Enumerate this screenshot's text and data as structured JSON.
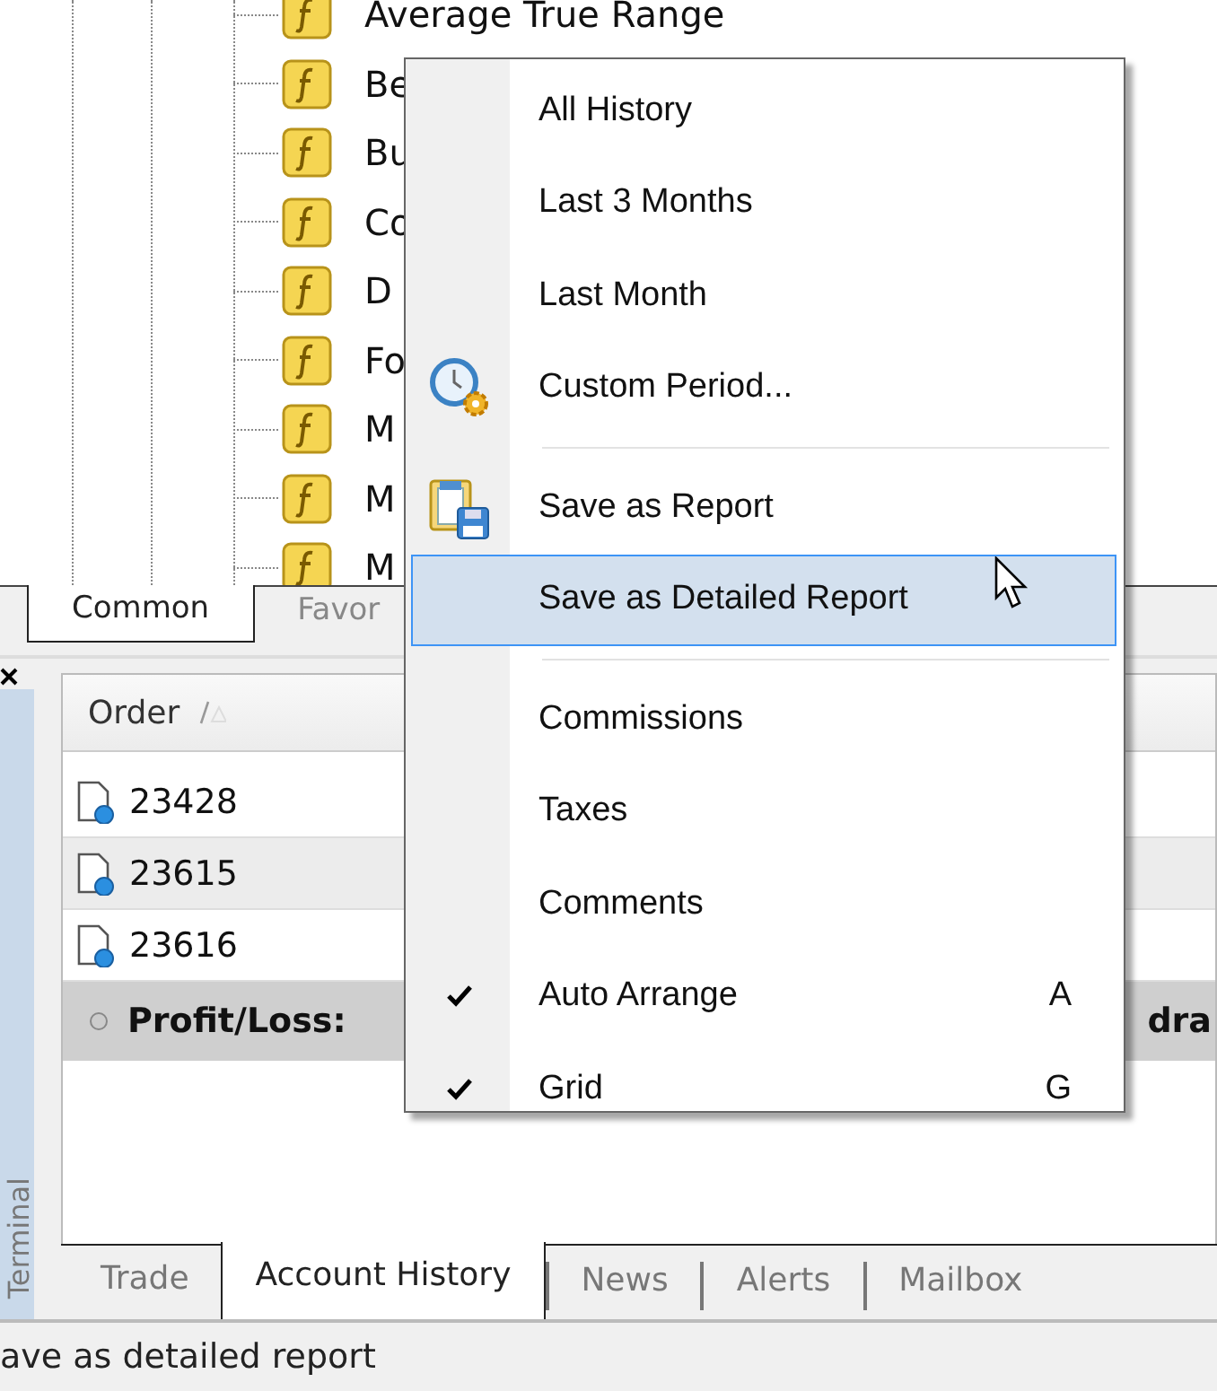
{
  "navigator": {
    "items": [
      {
        "label": "Average True Range"
      },
      {
        "label": "Be"
      },
      {
        "label": "Bu"
      },
      {
        "label": "Co"
      },
      {
        "label": "D"
      },
      {
        "label": "Fo"
      },
      {
        "label": "M"
      },
      {
        "label": "M"
      },
      {
        "label": "M"
      }
    ],
    "tabs": [
      {
        "label": "Common",
        "selected": true
      },
      {
        "label": "Favor",
        "selected": false
      }
    ]
  },
  "terminal": {
    "title": "Terminal",
    "columns": [
      "Order"
    ],
    "rows": [
      {
        "order": "23428"
      },
      {
        "order": "23615"
      },
      {
        "order": "23616"
      }
    ],
    "summary": {
      "text": "Profit/Loss:",
      "trailing": "dra"
    },
    "tabs": [
      {
        "label": "Trade",
        "selected": false
      },
      {
        "label": "Account History",
        "selected": true
      },
      {
        "label": "News",
        "selected": false
      },
      {
        "label": "Alerts",
        "selected": false
      },
      {
        "label": "Mailbox",
        "selected": false
      }
    ]
  },
  "status_bar": "ave as detailed report",
  "context_menu": {
    "items": [
      {
        "kind": "item",
        "label": "All History",
        "selected": false,
        "checked": false
      },
      {
        "kind": "item",
        "label": "Last 3 Months",
        "selected": false,
        "checked": false
      },
      {
        "kind": "item",
        "label": "Last Month",
        "selected": false,
        "checked": false
      },
      {
        "kind": "icon_item",
        "label": "Custom Period...",
        "selected": false,
        "checked": false
      },
      {
        "kind": "separator"
      },
      {
        "kind": "icon_item",
        "label": "Save as Report",
        "selected": false,
        "checked": false
      },
      {
        "kind": "item",
        "label": "Save as Detailed Report",
        "selected": true,
        "checked": false
      },
      {
        "kind": "separator"
      },
      {
        "kind": "item",
        "label": "Commissions",
        "selected": false,
        "checked": false
      },
      {
        "kind": "item",
        "label": "Taxes",
        "selected": false,
        "checked": false
      },
      {
        "kind": "item",
        "label": "Comments",
        "selected": false,
        "checked": false
      },
      {
        "kind": "item",
        "label": "Auto Arrange",
        "selected": false,
        "checked": true,
        "shortcut": "A"
      },
      {
        "kind": "item",
        "label": "Grid",
        "selected": false,
        "checked": true,
        "shortcut": "G"
      }
    ]
  }
}
